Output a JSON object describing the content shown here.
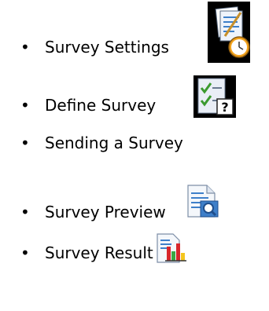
{
  "list": {
    "items": [
      {
        "label": "Survey Settings",
        "icon": "survey-settings-clock-icon"
      },
      {
        "label": "Define Survey",
        "icon": "checklist-question-icon"
      },
      {
        "label": "Sending a Survey",
        "icon": ""
      },
      {
        "label": "Survey Preview",
        "icon": "document-magnifier-icon"
      },
      {
        "label": "Survey Result",
        "icon": "report-bar-chart-icon"
      }
    ],
    "bullet": "•"
  },
  "colors": {
    "text": "#000000",
    "background": "#ffffff",
    "icon_dark_bg": "#000000",
    "clock_orange": "#f2a21c",
    "check_green": "#3b9a2f",
    "doc_blue": "#3e7fc9",
    "bar_red": "#d8262b",
    "bar_green": "#3aa843",
    "bar_yellow": "#f4c51d"
  }
}
